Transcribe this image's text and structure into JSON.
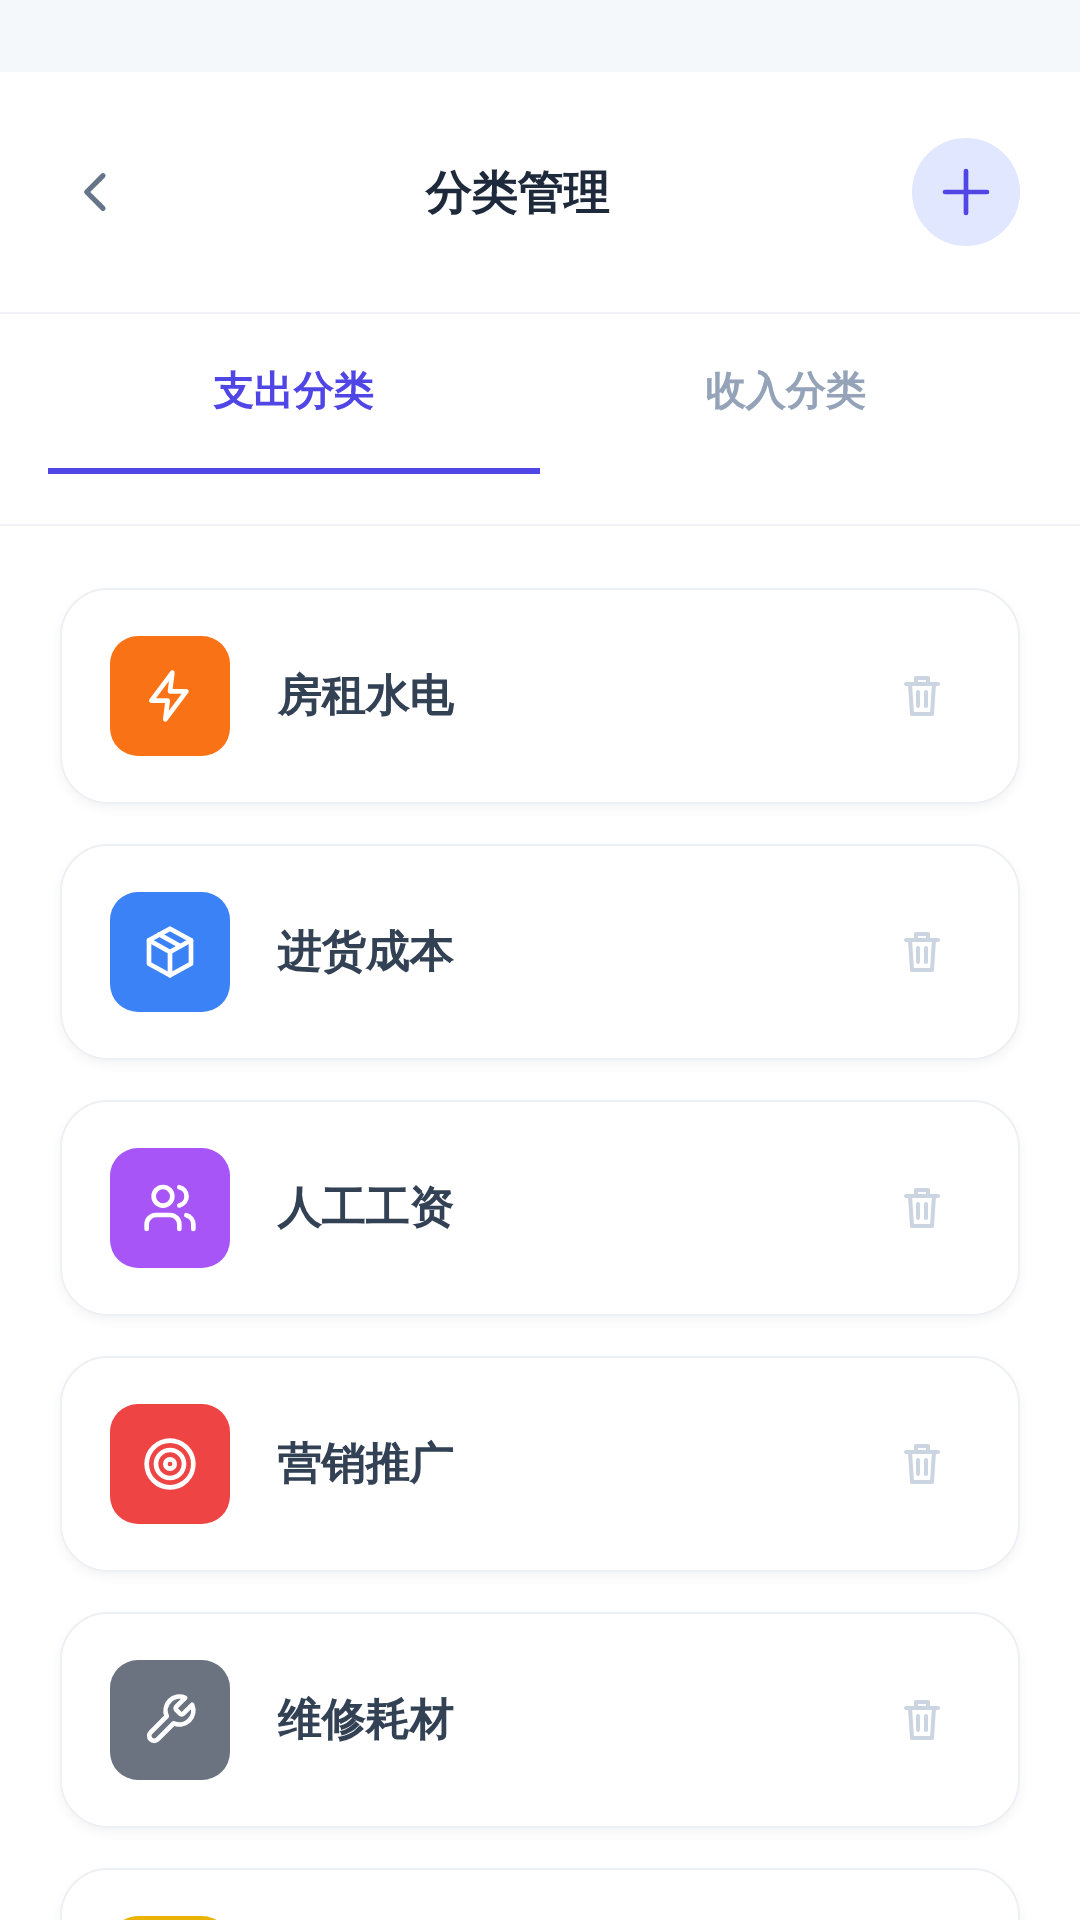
{
  "header": {
    "title": "分类管理"
  },
  "tabs": [
    {
      "label": "支出分类",
      "selected": true
    },
    {
      "label": "收入分类",
      "selected": false
    }
  ],
  "categories": [
    {
      "name": "房租水电",
      "kind": "bolt",
      "color": "#f97316"
    },
    {
      "name": "进货成本",
      "kind": "box",
      "color": "#3b82f6"
    },
    {
      "name": "人工工资",
      "kind": "users",
      "color": "#a855f7"
    },
    {
      "name": "营销推广",
      "kind": "target",
      "color": "#ef4444"
    },
    {
      "name": "维修耗材",
      "kind": "wrench",
      "color": "#6b7280"
    },
    {
      "color": "#eab308"
    }
  ]
}
